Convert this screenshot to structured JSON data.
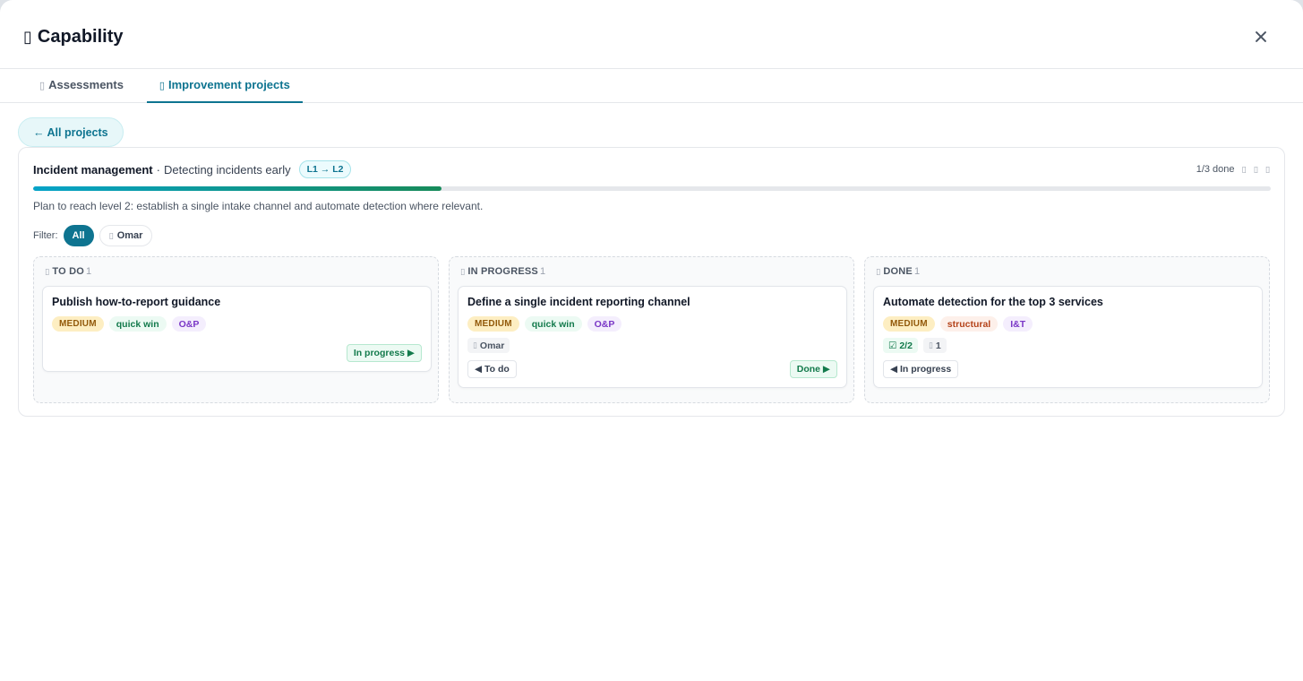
{
  "dialog": {
    "title": "Capability",
    "title_icon": "capability-icon"
  },
  "tabs": [
    {
      "label": "Assessments",
      "icon": "assessment-icon",
      "active": false
    },
    {
      "label": "Improvement projects",
      "icon": "project-icon",
      "active": true
    }
  ],
  "back_label": "← All projects",
  "project": {
    "name": "Incident management",
    "separator": "·",
    "subtitle": "Detecting incidents early",
    "level_badge": "L1 → L2",
    "done_summary": "1/3 done",
    "progress_fraction": 0.33,
    "description": "Plan to reach level 2: establish a single intake channel and automate detection where relevant.",
    "filter_label": "Filter:",
    "filters": [
      {
        "label": "All",
        "active": true
      },
      {
        "label": "Omar",
        "active": false,
        "icon": "user-icon"
      }
    ],
    "action_icons": [
      "copy-icon",
      "export-icon",
      "delete-icon"
    ]
  },
  "columns": [
    {
      "title": "TO DO",
      "count": "1",
      "icon": "todo-icon",
      "cards": [
        {
          "title": "Publish how-to-report guidance",
          "priority": "MEDIUM",
          "kind": "quick win",
          "category": "O&P",
          "forward": "In progress ▶"
        }
      ]
    },
    {
      "title": "IN PROGRESS",
      "count": "1",
      "icon": "in-progress-icon",
      "cards": [
        {
          "title": "Define a single incident reporting channel",
          "priority": "MEDIUM",
          "kind": "quick win",
          "category": "O&P",
          "assignee": "Omar",
          "back": "◀ To do",
          "forward": "Done ▶"
        }
      ]
    },
    {
      "title": "DONE",
      "count": "1",
      "icon": "done-icon",
      "cards": [
        {
          "title": "Automate detection for the top 3 services",
          "priority": "MEDIUM",
          "kind": "structural",
          "category": "I&T",
          "checklist": "☑ 2/2",
          "comments": "1",
          "back": "◀ In progress"
        }
      ]
    }
  ],
  "colors": {
    "accent": "#0e7490",
    "progress_start": "#06a3c8",
    "progress_end": "#178b5a"
  }
}
